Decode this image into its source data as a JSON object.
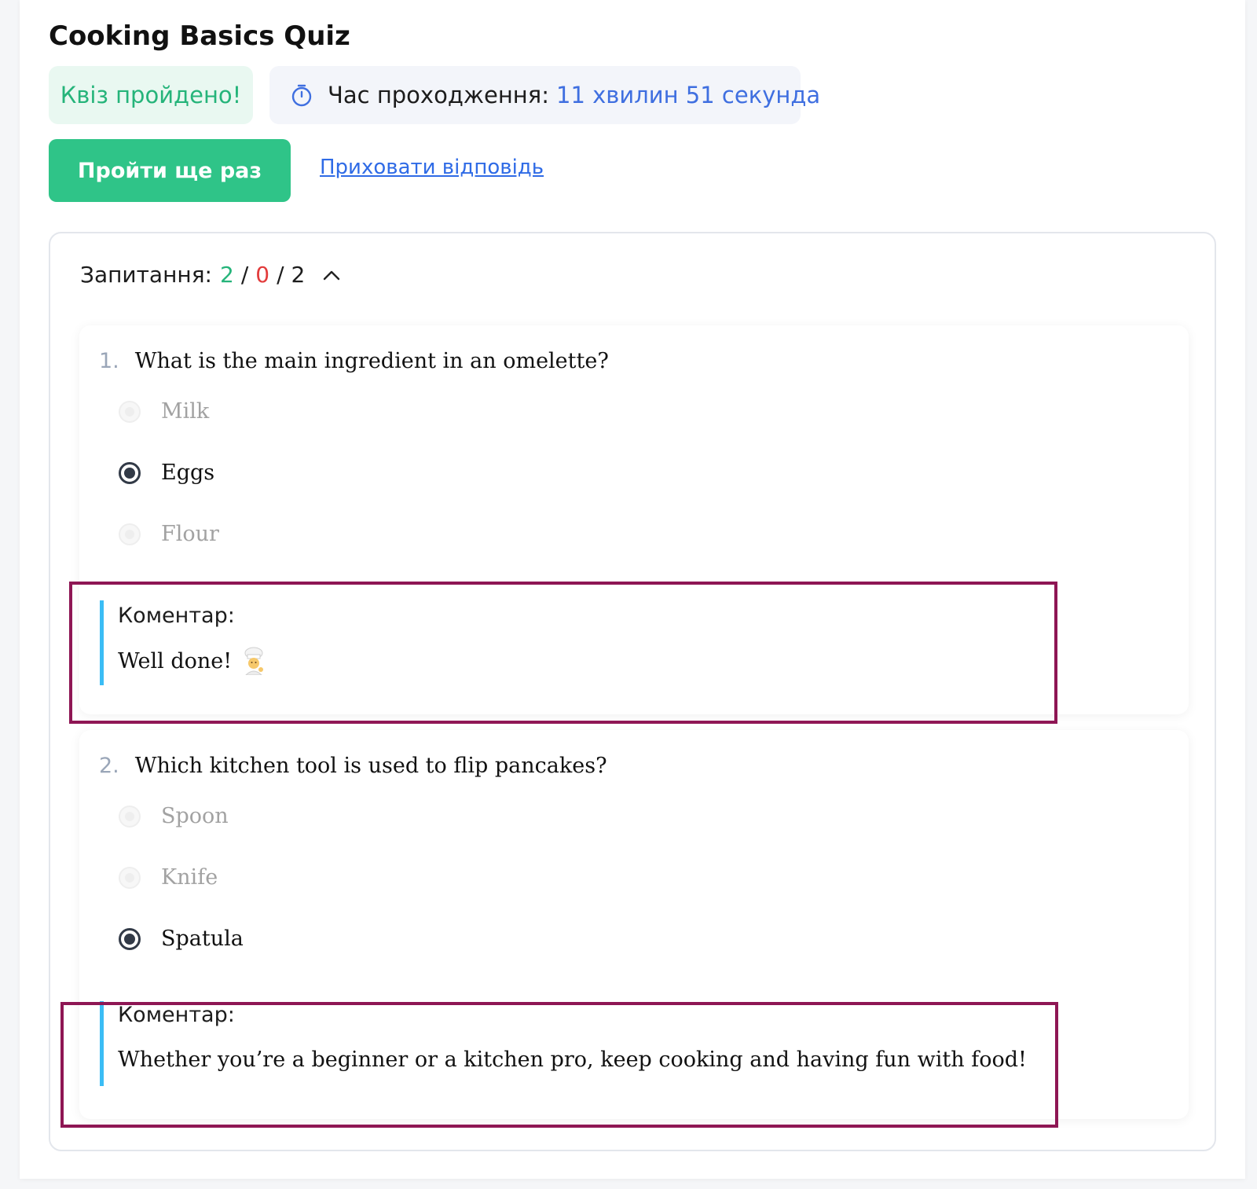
{
  "quiz": {
    "title": "Cooking Basics Quiz",
    "status": "Квіз пройдено!",
    "time_label": "Час проходження:",
    "time_value": "11 хвилин 51 секунда",
    "retry_label": "Пройти ще раз",
    "hide_answers_label": "Приховати відповідь"
  },
  "summary": {
    "label": "Запитання:",
    "correct": "2",
    "wrong": "0",
    "total": "2",
    "separator": "/"
  },
  "questions": [
    {
      "number": "1.",
      "text": "What is the main ingredient in an omelette?",
      "options": [
        {
          "label": "Milk",
          "selected": false
        },
        {
          "label": "Eggs",
          "selected": true
        },
        {
          "label": "Flour",
          "selected": false
        }
      ],
      "comment_label": "Коментар:",
      "comment_text": "Well done!"
    },
    {
      "number": "2.",
      "text": "Which kitchen tool is used to flip pancakes?",
      "options": [
        {
          "label": "Spoon",
          "selected": false
        },
        {
          "label": "Knife",
          "selected": false
        },
        {
          "label": "Spatula",
          "selected": true
        }
      ],
      "comment_label": "Коментар:",
      "comment_text": "Whether you’re a beginner or a kitchen pro, keep cooking and having fun with food!"
    }
  ],
  "icons": {
    "timer": "stopwatch-icon",
    "collapse": "chevron-up-icon",
    "chef": "chef-emoji-icon"
  },
  "colors": {
    "success": "#2fc488",
    "error": "#e23b3b",
    "link": "#2f6be6",
    "comment_bar": "#3bbdf5",
    "highlight": "#8e1654"
  }
}
